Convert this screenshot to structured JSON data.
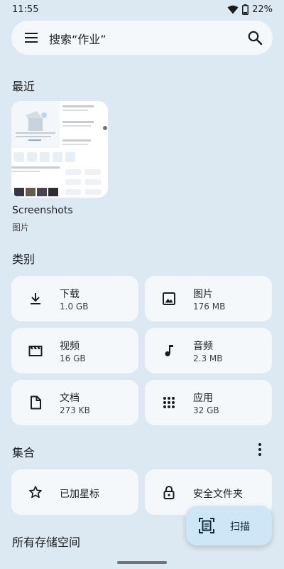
{
  "status_bar": {
    "time": "11:55",
    "battery": "22%"
  },
  "search": {
    "placeholder": "搜索“作业”"
  },
  "recent": {
    "title": "最近",
    "item_name": "Screenshots",
    "item_type": "图片"
  },
  "categories": {
    "title": "类别",
    "items": [
      {
        "label": "下载",
        "size": "1.0 GB",
        "icon": "download-icon"
      },
      {
        "label": "图片",
        "size": "176 MB",
        "icon": "image-icon"
      },
      {
        "label": "视频",
        "size": "16 GB",
        "icon": "video-icon"
      },
      {
        "label": "音频",
        "size": "2.3 MB",
        "icon": "audio-icon"
      },
      {
        "label": "文档",
        "size": "273 KB",
        "icon": "document-icon"
      },
      {
        "label": "应用",
        "size": "32 GB",
        "icon": "apps-icon"
      }
    ]
  },
  "collections": {
    "title": "集合",
    "items": [
      {
        "label": "已加星标",
        "icon": "star-icon"
      },
      {
        "label": "安全文件夹",
        "icon": "lock-icon"
      }
    ]
  },
  "storage": {
    "title": "所有存储空间"
  },
  "fab": {
    "label": "扫描",
    "icon": "scan-icon"
  },
  "colors": {
    "background": "#dde9f2",
    "card": "#f4f8fb",
    "fab": "#cfe6f7"
  }
}
